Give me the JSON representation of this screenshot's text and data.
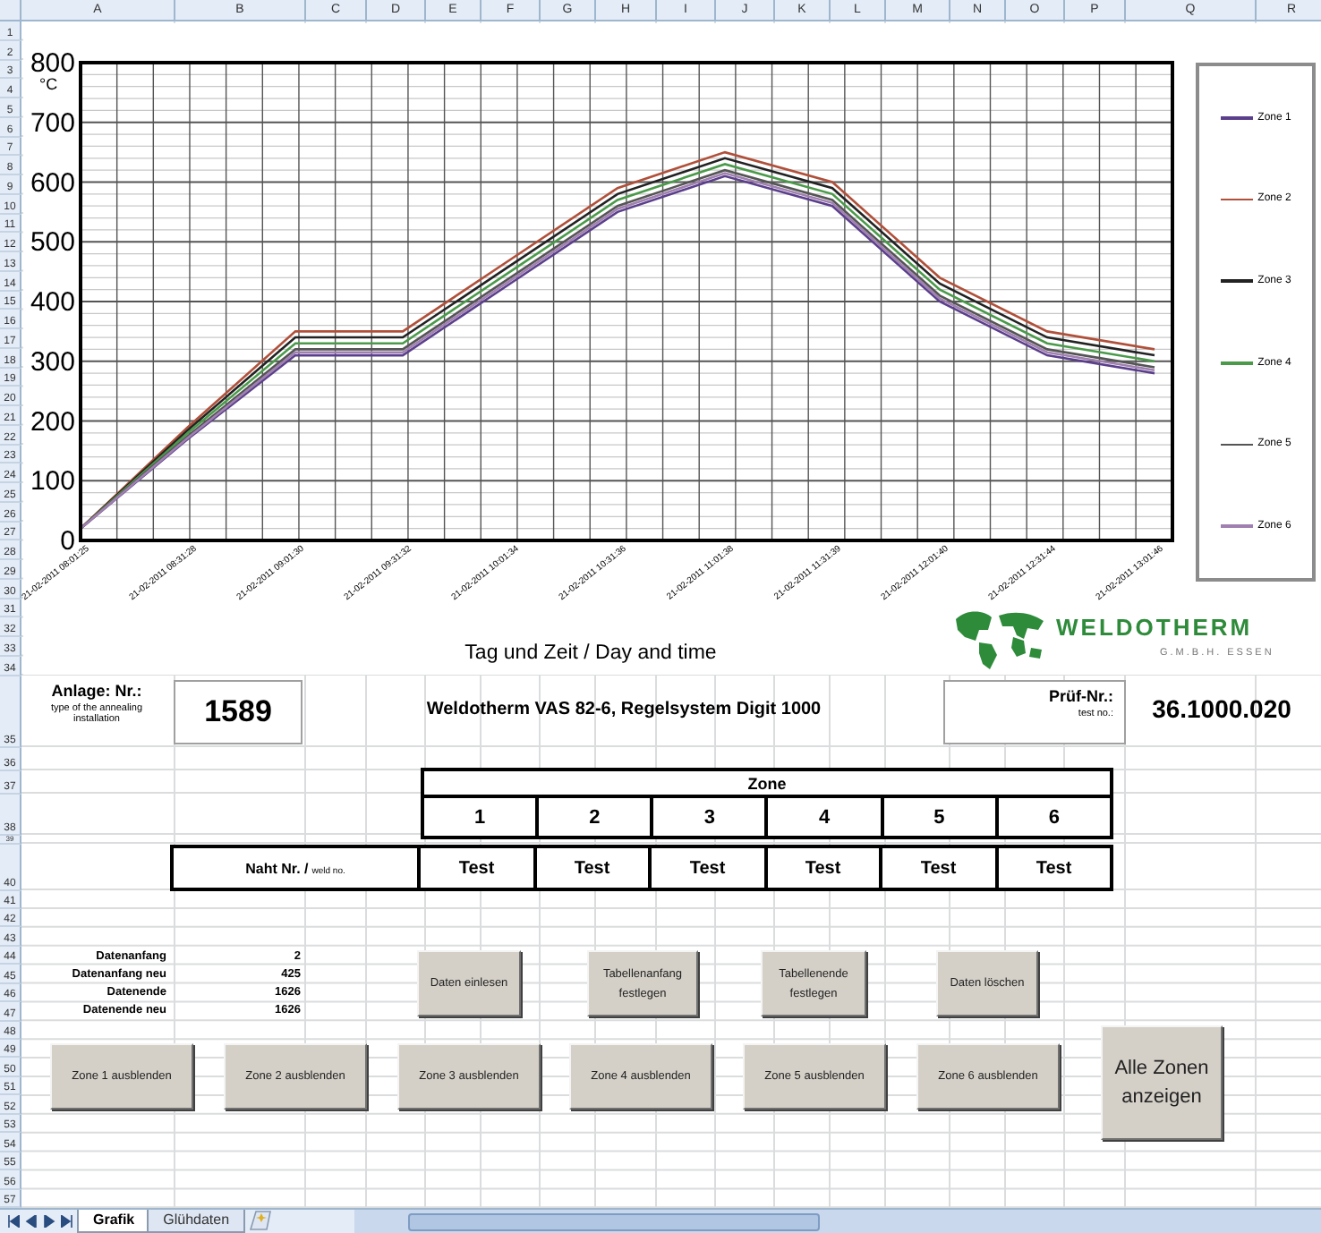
{
  "sheet": {
    "column_headers": [
      "A",
      "B",
      "C",
      "D",
      "E",
      "F",
      "G",
      "H",
      "I",
      "J",
      "K",
      "L",
      "M",
      "N",
      "O",
      "P",
      "Q",
      "R"
    ],
    "row_numbers": [
      "1",
      "2",
      "3",
      "4",
      "5",
      "6",
      "7",
      "8",
      "9",
      "10",
      "11",
      "12",
      "13",
      "14",
      "15",
      "16",
      "17",
      "18",
      "19",
      "20",
      "21",
      "22",
      "23",
      "24",
      "25",
      "26",
      "27",
      "28",
      "29",
      "30",
      "31",
      "32",
      "33",
      "34",
      "35",
      "36",
      "37",
      "38",
      "39",
      "40",
      "41",
      "42",
      "43",
      "44",
      "45",
      "46",
      "47",
      "48",
      "49",
      "50",
      "51",
      "52",
      "53",
      "54",
      "55",
      "56",
      "57"
    ]
  },
  "chart": {
    "chart_data": {
      "type": "line",
      "xlabel": "Tag und Zeit / Day and time",
      "ylabel": "°C",
      "categories": [
        "21-02-2011 08:01:25",
        "21-02-2011 08:31:28",
        "21-02-2011 09:01:30",
        "21-02-2011 09:31:32",
        "21-02-2011 10:01:34",
        "21-02-2011 10:31:36",
        "21-02-2011 11:01:38",
        "21-02-2011 11:31:39",
        "21-02-2011 12:01:40",
        "21-02-2011 12:31:44",
        "21-02-2011 13:01:46"
      ],
      "series": [
        {
          "name": "Zone 1",
          "color": "#5b3f8c",
          "values": [
            20,
            170,
            310,
            310,
            430,
            550,
            610,
            560,
            400,
            310,
            280
          ]
        },
        {
          "name": "Zone 2",
          "color": "#b0503a",
          "values": [
            20,
            190,
            350,
            350,
            470,
            590,
            650,
            600,
            440,
            350,
            320
          ]
        },
        {
          "name": "Zone 3",
          "color": "#222222",
          "values": [
            20,
            185,
            340,
            340,
            460,
            580,
            640,
            590,
            430,
            340,
            310
          ]
        },
        {
          "name": "Zone 4",
          "color": "#4a9a4a",
          "values": [
            20,
            180,
            330,
            330,
            450,
            570,
            630,
            580,
            420,
            330,
            300
          ]
        },
        {
          "name": "Zone 5",
          "color": "#555555",
          "values": [
            20,
            175,
            320,
            320,
            440,
            560,
            620,
            570,
            410,
            320,
            290
          ]
        },
        {
          "name": "Zone 6",
          "color": "#a080b0",
          "values": [
            20,
            172,
            315,
            315,
            435,
            555,
            615,
            565,
            405,
            315,
            285
          ]
        }
      ],
      "grid": true,
      "ylim": [
        0,
        800
      ],
      "yticks": [
        0,
        100,
        200,
        300,
        400,
        500,
        600,
        700,
        800
      ]
    },
    "logo": {
      "name": "WELDOTHERM",
      "subtitle": "G.M.B.H. ESSEN"
    }
  },
  "installation": {
    "label": "Anlage: Nr.:",
    "sublabel": "type of the annealing installation",
    "number": "1589",
    "description": "Weldotherm VAS 82-6, Regelsystem Digit 1000"
  },
  "test": {
    "label": "Prüf-Nr.:",
    "sublabel": "test no.:",
    "number": "36.1000.020"
  },
  "zone_table": {
    "title": "Zone",
    "zones": [
      "1",
      "2",
      "3",
      "4",
      "5",
      "6"
    ],
    "row_label": "Naht Nr. /",
    "row_label_small": "weld no.",
    "welds": [
      "Test",
      "Test",
      "Test",
      "Test",
      "Test",
      "Test"
    ]
  },
  "data_info": [
    {
      "label": "Datenanfang",
      "value": "2"
    },
    {
      "label": "Datenanfang neu",
      "value": "425"
    },
    {
      "label": "Datenende",
      "value": "1626"
    },
    {
      "label": "Datenende neu",
      "value": "1626"
    }
  ],
  "buttons_top": [
    "Daten einlesen",
    "Tabellenanfang festlegen",
    "Tabellenende festlegen",
    "Daten löschen"
  ],
  "buttons_zone": [
    "Zone 1 ausblenden",
    "Zone 2 ausblenden",
    "Zone 3 ausblenden",
    "Zone 4 ausblenden",
    "Zone 5 ausblenden",
    "Zone 6 ausblenden"
  ],
  "button_all": "Alle Zonen anzeigen",
  "sheet_tabs": [
    {
      "label": "Grafik",
      "selected": true
    },
    {
      "label": "Glühdaten",
      "selected": false
    }
  ]
}
